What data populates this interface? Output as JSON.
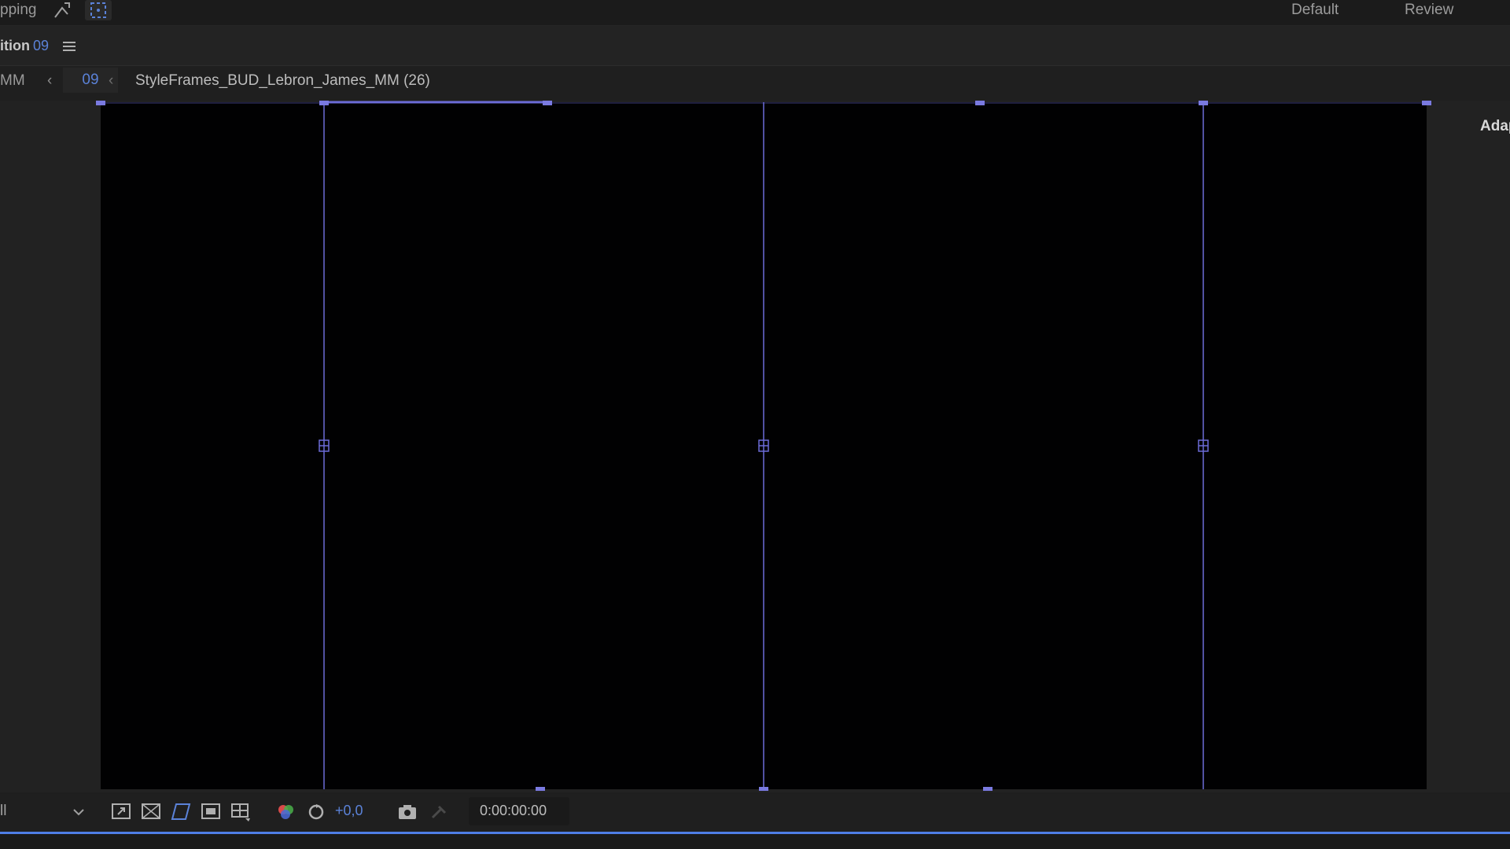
{
  "topbar": {
    "snapping_label": "pping",
    "workspaces": [
      "Default",
      "Review"
    ]
  },
  "panel": {
    "title": "ition",
    "number": "09",
    "menu_icon": "hamburger-menu-icon"
  },
  "breadcrumb": {
    "left_item": "MM",
    "active_item": "09",
    "composition": "StyleFrames_BUD_Lebron_James_MM (26)"
  },
  "viewer": {
    "right_panel_label": "Adap",
    "guide_color": "#6c6cd8"
  },
  "bottom_toolbar": {
    "resolution_label": "ll",
    "exposure": "+0,0",
    "timecode": "0:00:00:00"
  },
  "colors": {
    "accent": "#5b82d8",
    "background": "#1e1e1e",
    "canvas": "#010102"
  }
}
